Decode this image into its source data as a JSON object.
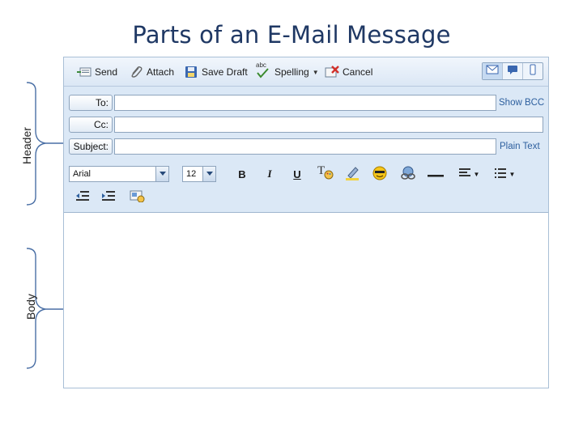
{
  "slide": {
    "title": "Parts of an E-Mail Message",
    "braces": {
      "header_label": "Header",
      "body_label": "Body"
    }
  },
  "toolbar": {
    "send_label": "Send",
    "attach_label": "Attach",
    "save_draft_label": "Save Draft",
    "spelling_label": "Spelling",
    "cancel_label": "Cancel",
    "spelling_icon_text": "abc"
  },
  "fields": {
    "to_label": "To:",
    "cc_label": "Cc:",
    "subject_label": "Subject:",
    "to_value": "",
    "cc_value": "",
    "subject_value": "",
    "show_bcc_link": "Show BCC",
    "plain_text_link": "Plain Text"
  },
  "formatting": {
    "font_value": "Arial",
    "size_value": "12",
    "bold_label": "B",
    "italic_label": "I",
    "underline_label": "U",
    "font_style_label": "T"
  },
  "body": {
    "text": ""
  },
  "colors": {
    "title": "#1f3864",
    "header_bg": "#dbe8f6",
    "link": "#2d5f9e",
    "border": "#8ea4bd"
  }
}
